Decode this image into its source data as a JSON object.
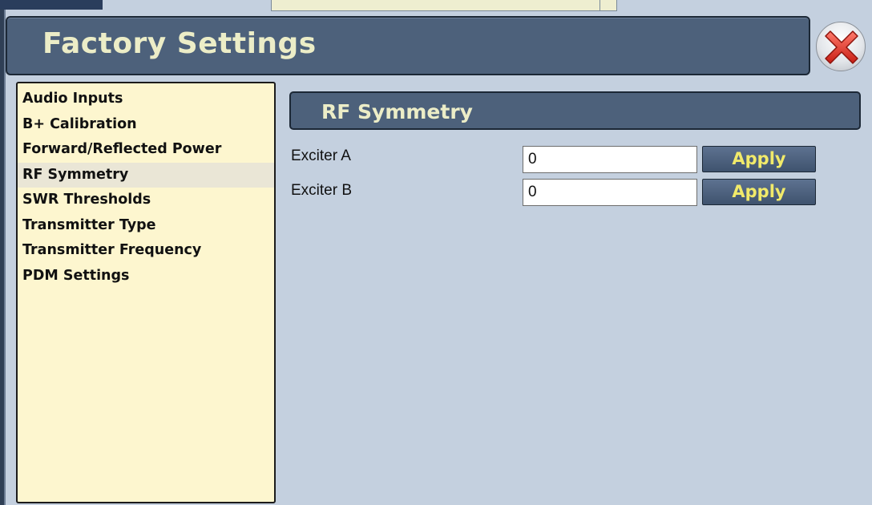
{
  "window": {
    "title": "Factory Settings",
    "close_icon": "close-x-icon"
  },
  "sidebar": {
    "selected_index": 3,
    "items": [
      {
        "label": "Audio Inputs"
      },
      {
        "label": "B+ Calibration"
      },
      {
        "label": "Forward/Reflected Power"
      },
      {
        "label": "RF Symmetry"
      },
      {
        "label": "SWR Thresholds"
      },
      {
        "label": "Transmitter Type"
      },
      {
        "label": "Transmitter Frequency"
      },
      {
        "label": "PDM Settings"
      }
    ]
  },
  "main": {
    "section_title": "RF Symmetry",
    "fields": [
      {
        "label": "Exciter A",
        "value": "0",
        "button_label": "Apply"
      },
      {
        "label": "Exciter B",
        "value": "0",
        "button_label": "Apply"
      }
    ]
  },
  "colors": {
    "header_bg": "#4d617b",
    "title_text": "#ecedc7",
    "sidebar_bg": "#fdf6cf",
    "content_bg": "#c4d0df",
    "apply_text": "#f1ea6a",
    "close_red": "#e23b2e"
  }
}
